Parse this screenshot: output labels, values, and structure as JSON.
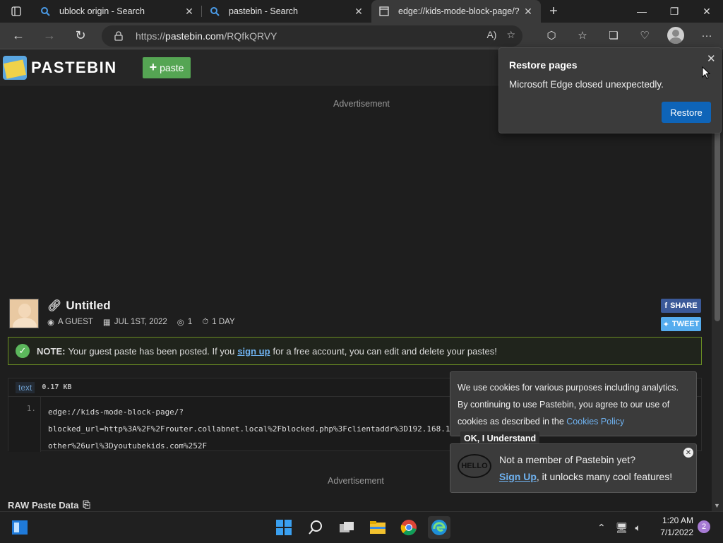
{
  "tabs": [
    {
      "label": "ublock origin - Search",
      "icon": "search-icon"
    },
    {
      "label": "pastebin - Search",
      "icon": "search-icon"
    },
    {
      "label": "edge://kids-mode-block-page/?",
      "icon": "edge-page-icon"
    }
  ],
  "address": {
    "scheme": "https://",
    "host": "pastebin.com",
    "path": "/RQfkQRVY"
  },
  "site": {
    "logo_text": "PASTEBIN",
    "paste_button": "paste",
    "ad_label": "Advertisement"
  },
  "paste": {
    "title": "Untitled",
    "author": "A GUEST",
    "date": "JUL 1ST, 2022",
    "views": "1",
    "expire": "1 DAY",
    "share": "SHARE",
    "tweet": "TWEET",
    "lang": "text",
    "size": "0.17 KB",
    "line_number": "1.",
    "code_lines": [
      "edge://kids-mode-block-page/?",
      "blocked_url=http%3A%2F%2Frouter.collabnet.local%2Fblocked.php%3Fclientaddr%3D192.168.1",
      "other%26url%3Dyoutubekids.com%252F"
    ]
  },
  "notice": {
    "strong": "NOTE:",
    "before": "Your guest paste has been posted. If you",
    "link": "sign up",
    "after": "for a free account, you can edit and delete your pastes!"
  },
  "raw_title": "RAW Paste Data",
  "restore": {
    "title": "Restore pages",
    "message": "Microsoft Edge closed unexpectedly.",
    "button": "Restore"
  },
  "cookie": {
    "text1": "We use cookies for various purposes including analytics. By continuing to use Pastebin, you agree to our use of cookies as described in the",
    "link": "Cookies Policy",
    "ok": "OK, I Understand"
  },
  "member": {
    "hello": "HELLO",
    "line1": "Not a member of Pastebin yet?",
    "link": "Sign Up",
    "line2": ", it unlocks many cool features!"
  },
  "clock": {
    "time": "1:20 AM",
    "date": "7/1/2022"
  },
  "notifications": "2",
  "colors": {
    "accent": "#0e64b8",
    "paste_green": "#55a553",
    "link": "#6fb2f0"
  }
}
